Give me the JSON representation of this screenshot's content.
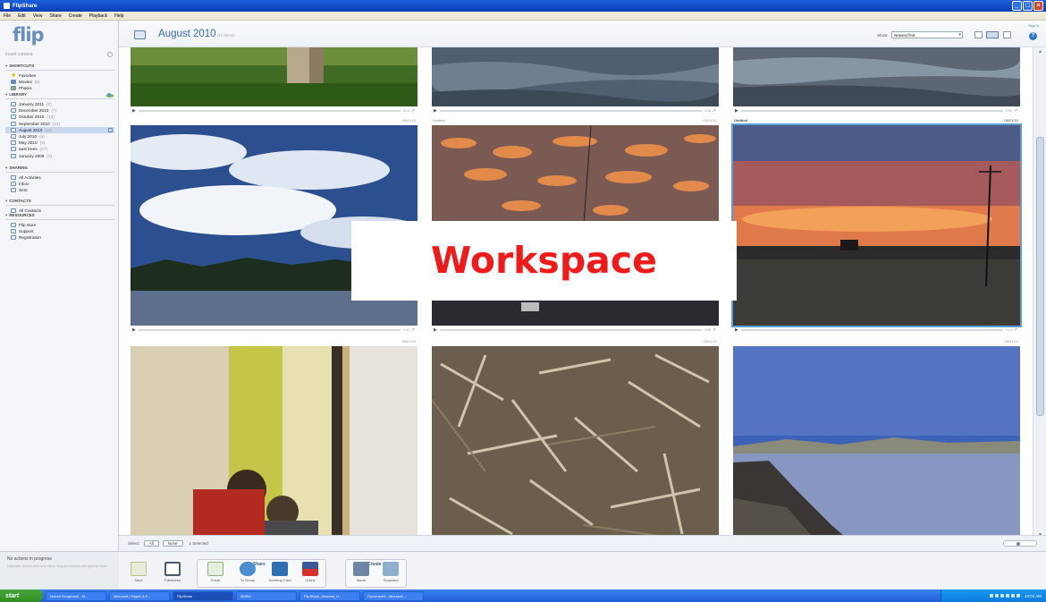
{
  "window": {
    "title": "FlipShare"
  },
  "menu": [
    "File",
    "Edit",
    "View",
    "Share",
    "Create",
    "Playback",
    "Help"
  ],
  "sidebar": {
    "logo": "flip",
    "camera_label": "Insert camera",
    "shortcuts": {
      "title": "SHORTCUTS",
      "items": [
        {
          "label": "Favorites",
          "count": ""
        },
        {
          "label": "Movies",
          "count": "(0)"
        },
        {
          "label": "Photos",
          "count": ""
        }
      ]
    },
    "library": {
      "title": "LIBRARY",
      "items": [
        {
          "label": "January 2011",
          "count": "(0)"
        },
        {
          "label": "December 2010",
          "count": "(7)"
        },
        {
          "label": "October 2010",
          "count": "(14)"
        },
        {
          "label": "September 2010",
          "count": "(44)"
        },
        {
          "label": "August 2010",
          "count": "(11)"
        },
        {
          "label": "July 2010",
          "count": "(6)"
        },
        {
          "label": "May 2010",
          "count": "(3)"
        },
        {
          "label": "aust trees",
          "count": "(27)"
        },
        {
          "label": "January 2009",
          "count": "(3)"
        }
      ]
    },
    "sharing": {
      "title": "SHARING",
      "items": [
        {
          "label": "All Activities"
        },
        {
          "label": "Inbox"
        },
        {
          "label": "Sent"
        }
      ]
    },
    "contacts": {
      "title": "CONTACTS",
      "items": [
        {
          "label": "All Contacts"
        }
      ]
    },
    "resources": {
      "title": "RESOURCES",
      "items": [
        {
          "label": "Flip store"
        },
        {
          "label": "Support"
        },
        {
          "label": "Registration"
        }
      ]
    }
  },
  "progress": {
    "title": "No actions in progress",
    "detail": "Uploads, downloads and other long processes will appear here."
  },
  "header": {
    "folder_title": "August 2010",
    "folder_count": "(11 items)",
    "show_label": "Show:",
    "show_value": "Newest first",
    "sign_in": "Sign In",
    "help": "?"
  },
  "tiles": [
    {
      "name": "",
      "date": "",
      "time": "0:14"
    },
    {
      "name": "",
      "date": "",
      "time": "0:06"
    },
    {
      "name": "",
      "date": "",
      "time": "0:09"
    },
    {
      "name": "",
      "date": "08/21/10",
      "time": "0:11"
    },
    {
      "name": "Untitled",
      "date": "08/21/10",
      "time": "0:08"
    },
    {
      "name": "Untitled",
      "date": "08/21/10",
      "time": "0:14"
    },
    {
      "name": "",
      "date": "08/01/10",
      "time": ""
    },
    {
      "name": "",
      "date": "08/01/10",
      "time": ""
    },
    {
      "name": "",
      "date": "08/01/10",
      "time": ""
    }
  ],
  "footer": {
    "select_label": "Select:",
    "all_label": "All",
    "none_label": "None",
    "selected_text": "1 Selected"
  },
  "overlay": {
    "label": "Workspace"
  },
  "toolbar": {
    "save_label": "Save",
    "fullscreen_label": "Fullscreen",
    "share_title": "Share",
    "email_label": "Email",
    "to_group_label": "To Group",
    "greeting_label": "Greeting Card",
    "online_label": "Online",
    "create_title": "Create",
    "movie_label": "Movie",
    "snapshot_label": "Snapshot"
  },
  "taskbar": {
    "start": "start",
    "items": [
      "Norrell Scrapbook - M...",
      "Microsoft | Pages & F...",
      "FlipShare",
      "NOBO",
      "FlipShare_Screens_H...",
      "Document1 - Microsof..."
    ],
    "clock": "10:02 AM"
  }
}
